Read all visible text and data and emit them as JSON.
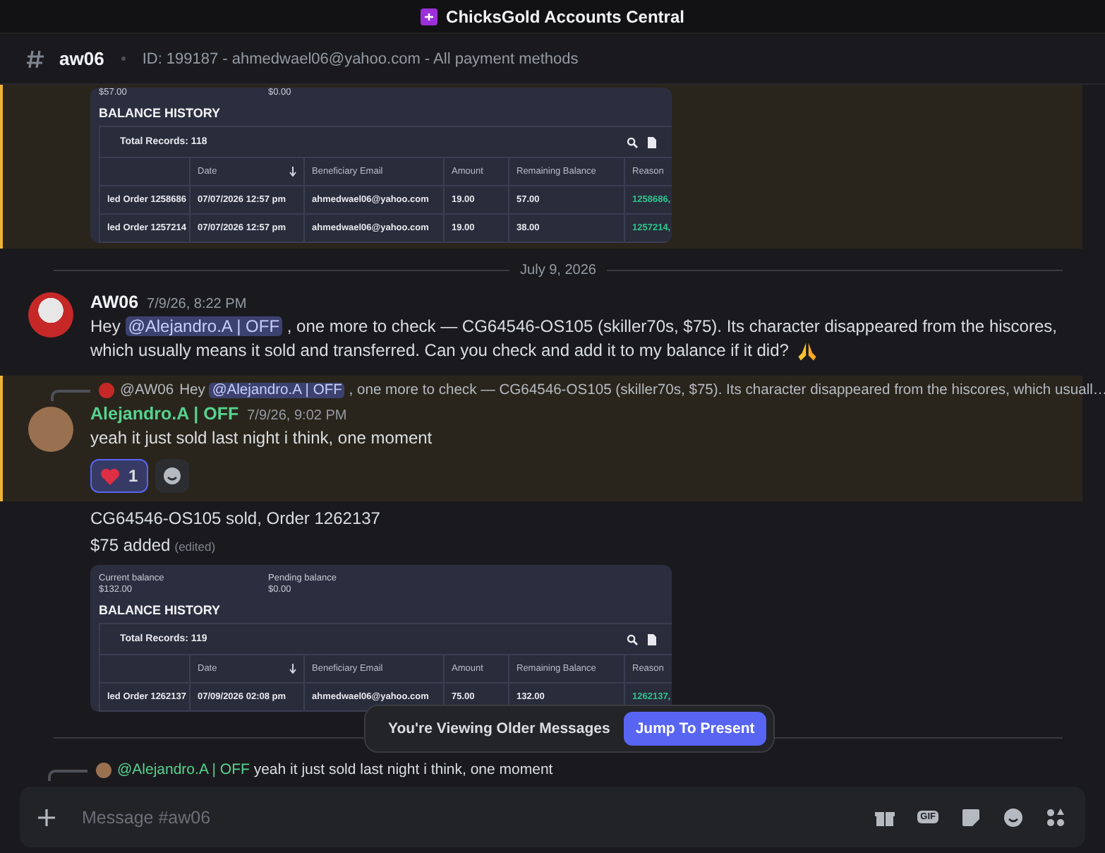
{
  "app": {
    "title": "ChicksGold Accounts Central"
  },
  "channel": {
    "name": "aw06",
    "topic": "ID: 199187 - ahmedwael06@yahoo.com - All payment methods"
  },
  "messages": [
    {
      "kind": "attachment",
      "highlighted": true,
      "screenshot": {
        "balances": [
          {
            "value": "$57.00"
          },
          {
            "value": "$0.00"
          }
        ],
        "title": "BALANCE HISTORY",
        "total": "Total Records: 118",
        "columns": [
          "",
          "Date",
          "Beneficiary Email",
          "Amount",
          "Remaining Balance",
          "Reason"
        ],
        "rows": [
          [
            "led Order 1258686",
            "07/07/2026 12:57 pm",
            "ahmedwael06@yahoo.com",
            "19.00",
            "57.00",
            "1258686,"
          ],
          [
            "led Order 1257214",
            "07/07/2026 12:57 pm",
            "ahmedwael06@yahoo.com",
            "19.00",
            "38.00",
            "1257214,"
          ]
        ]
      }
    },
    {
      "kind": "divider",
      "label": "July 9, 2026"
    },
    {
      "kind": "message",
      "highlighted": false,
      "author": "AW06",
      "color": "#f2f3f5",
      "time": "7/9/26, 8:22 PM",
      "parts": [
        {
          "kind": "text",
          "text": "Hey "
        },
        {
          "kind": "mention",
          "text": "@Alejandro.A | OFF"
        },
        {
          "kind": "text",
          "text": " , one more to check — CG64546-OS105 (skiller70s, $75). Its character disappeared from the hiscores, which usually means it sold and transferred. Can you check and add it to my balance if it did?"
        },
        {
          "kind": "emoji"
        }
      ]
    },
    {
      "kind": "message",
      "highlighted": true,
      "author": "Alejandro.A | OFF",
      "color": "#57d28f",
      "time": "7/9/26, 9:02 PM",
      "reply": {
        "author": "@AW06",
        "parts": [
          {
            "kind": "text",
            "text": "Hey "
          },
          {
            "kind": "mention",
            "text": "@Alejandro.A | OFF"
          },
          {
            "kind": "text",
            "text": " , one more to check — CG64546-OS105 (skiller70s, $75). Its character disappeared from the hiscores, which usuall…"
          }
        ]
      },
      "parts": [
        {
          "kind": "text",
          "text": "yeah it just sold last night i think, one moment"
        }
      ],
      "reactions": [
        {
          "count": "1",
          "selected": true
        }
      ]
    },
    {
      "kind": "continuation",
      "lines": [
        "CG64546-OS105 sold, Order 1262137",
        "$75 added"
      ],
      "edited": "(edited)",
      "screenshot": {
        "balances": [
          {
            "label": "Current balance",
            "value": "$132.00"
          },
          {
            "label": "Pending balance",
            "value": "$0.00"
          }
        ],
        "title": "BALANCE HISTORY",
        "total": "Total Records: 119",
        "columns": [
          "",
          "Date",
          "Beneficiary Email",
          "Amount",
          "Remaining Balance",
          "Reason"
        ],
        "rows": [
          [
            "led Order 1262137",
            "07/09/2026 02:08 pm",
            "ahmedwael06@yahoo.com",
            "75.00",
            "132.00",
            "1262137,"
          ]
        ]
      }
    },
    {
      "kind": "divider"
    },
    {
      "kind": "reply_preview",
      "mention": "@Alejandro.A | OFF",
      "text": "yeah it just sold last night i think, one moment"
    }
  ],
  "older_notice": {
    "text": "You're Viewing Older Messages",
    "button": "Jump To Present"
  },
  "composer": {
    "placeholder": "Message #aw06",
    "gif_label": "GIF"
  }
}
